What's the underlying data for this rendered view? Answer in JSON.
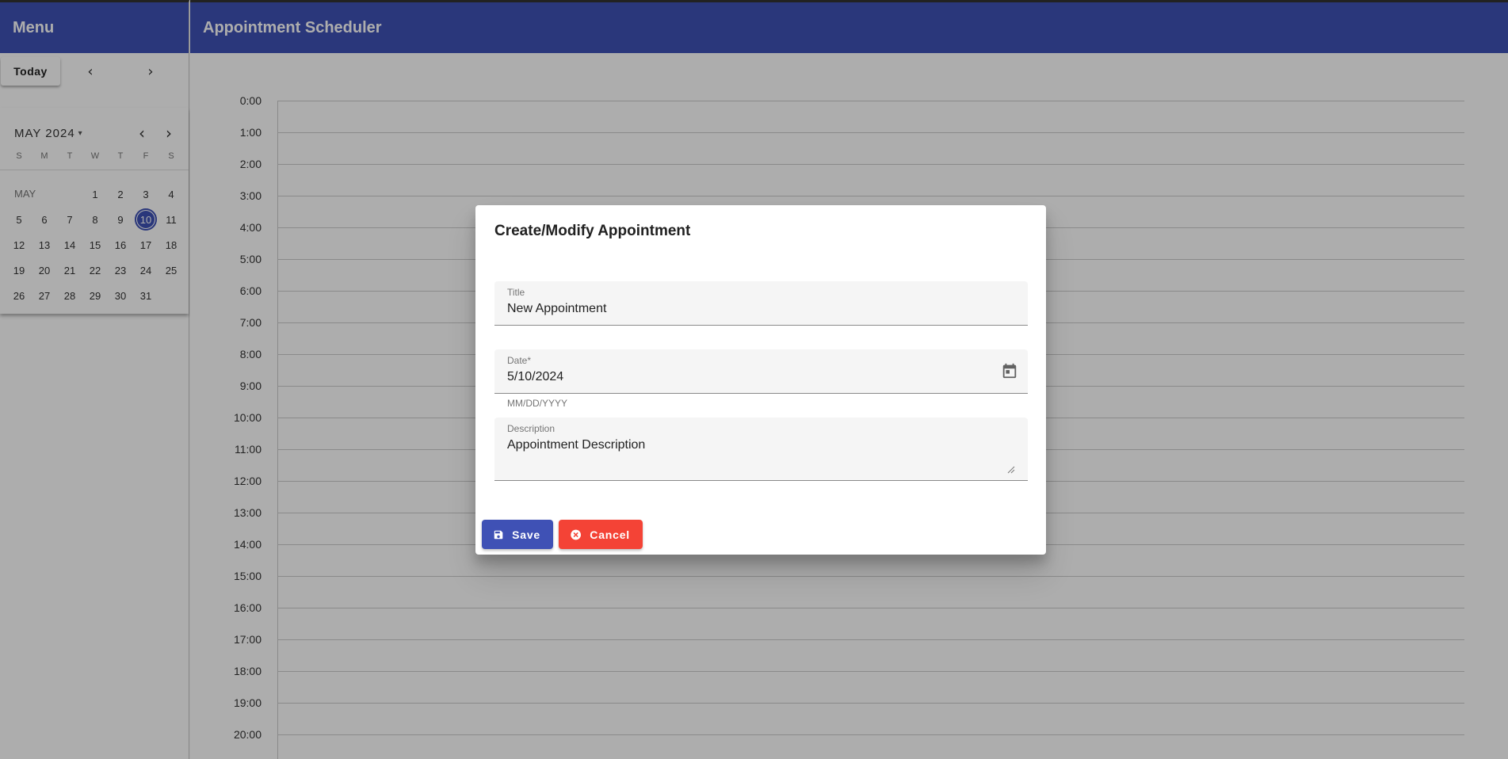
{
  "header": {
    "menu_title": "Menu",
    "app_title": "Appointment Scheduler"
  },
  "sidebar": {
    "today_label": "Today",
    "prev_arrow": "‹",
    "next_arrow": "›",
    "minical": {
      "month_label": "MAY 2024",
      "month_short": "MAY",
      "dropdown_icon": "▾",
      "prev_icon": "‹",
      "next_icon": "›",
      "weekdays": [
        "S",
        "M",
        "T",
        "W",
        "T",
        "F",
        "S"
      ],
      "leading_blanks": 3,
      "days": [
        "1",
        "2",
        "3",
        "4",
        "5",
        "6",
        "7",
        "8",
        "9",
        "10",
        "11",
        "12",
        "13",
        "14",
        "15",
        "16",
        "17",
        "18",
        "19",
        "20",
        "21",
        "22",
        "23",
        "24",
        "25",
        "26",
        "27",
        "28",
        "29",
        "30",
        "31"
      ],
      "selected_day": "10"
    }
  },
  "schedule": {
    "hours": [
      "0:00",
      "1:00",
      "2:00",
      "3:00",
      "4:00",
      "5:00",
      "6:00",
      "7:00",
      "8:00",
      "9:00",
      "10:00",
      "11:00",
      "12:00",
      "13:00",
      "14:00",
      "15:00",
      "16:00",
      "17:00",
      "18:00",
      "19:00",
      "20:00"
    ]
  },
  "dialog": {
    "title": "Create/Modify Appointment",
    "title_field": {
      "label": "Title",
      "value": "New Appointment"
    },
    "date_field": {
      "label": "Date*",
      "value": "5/10/2024",
      "hint": "MM/DD/YYYY",
      "icon": "calendar-icon"
    },
    "description_field": {
      "label": "Description",
      "value": "Appointment Description"
    },
    "save_label": "Save",
    "cancel_label": "Cancel"
  },
  "colors": {
    "primary": "#3f51b5",
    "danger": "#f44336"
  }
}
